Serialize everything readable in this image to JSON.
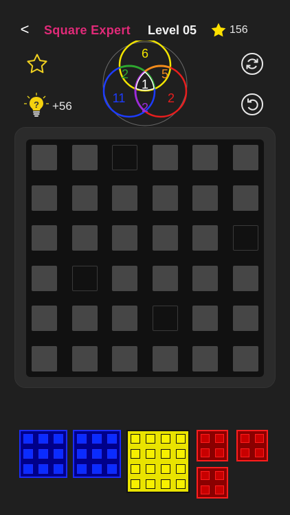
{
  "header": {
    "back_label": "<",
    "title": "Square Expert",
    "level": "Level 05",
    "stars_total": "156"
  },
  "hint": {
    "count": "+56"
  },
  "venn": {
    "top": "6",
    "left_top": "2",
    "right_top": "5",
    "center": "1",
    "left_bottom": "11",
    "bottom": "2",
    "right_bottom": "2",
    "colors": {
      "top": "#f2e400",
      "left": "#1d3cff",
      "right": "#e81e1e",
      "inner_left_top": "#2ea82e",
      "inner_right_top": "#f28c1b",
      "inner_bottom": "#9b2bd9",
      "center": "#ffffff"
    }
  },
  "board": {
    "rows": 6,
    "cols": 6,
    "empty_cells": [
      [
        0,
        2
      ],
      [
        2,
        5
      ],
      [
        3,
        1
      ],
      [
        4,
        3
      ]
    ],
    "cell_color": "#464646"
  },
  "pieces": [
    {
      "name": "blue-piece-1",
      "color": "blue",
      "rows": 3,
      "cols": 3
    },
    {
      "name": "blue-piece-2",
      "color": "blue",
      "rows": 3,
      "cols": 3
    },
    {
      "name": "yellow-piece",
      "color": "yellow",
      "rows": 4,
      "cols": 4
    },
    {
      "name": "red-piece-1",
      "color": "red",
      "rows": 2,
      "cols": 2
    },
    {
      "name": "red-piece-2",
      "color": "red",
      "rows": 2,
      "cols": 2
    },
    {
      "name": "red-piece-3",
      "color": "red",
      "rows": 2,
      "cols": 2
    }
  ],
  "icons": {
    "back": "chevron-left-icon",
    "star": "star-icon",
    "favorite": "star-outline-icon",
    "hint": "lightbulb-question-icon",
    "refresh": "refresh-icon",
    "undo": "undo-icon"
  }
}
